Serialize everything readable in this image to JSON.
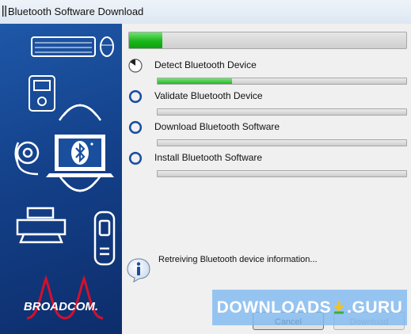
{
  "window": {
    "title": "Bluetooth Software Download"
  },
  "branding": {
    "logo_text": "BROADCOM."
  },
  "overall_progress": {
    "fraction": 0.12
  },
  "steps": [
    {
      "label": "Detect Bluetooth Device",
      "state": "in-progress",
      "progress": 0.3
    },
    {
      "label": "Validate Bluetooth Device",
      "state": "pending",
      "progress": 0
    },
    {
      "label": "Download Bluetooth Software",
      "state": "pending",
      "progress": 0
    },
    {
      "label": "Install Bluetooth Software",
      "state": "pending",
      "progress": 0
    }
  ],
  "status": {
    "message": "Retreiving Bluetooth device information...",
    "icon": "info-icon"
  },
  "buttons": {
    "cancel": "Cancel",
    "download": "Download"
  },
  "watermark": {
    "left": "DOWNLOADS",
    "right": ".GURU"
  },
  "colors": {
    "progress_green": "#19b619",
    "panel_blue": "#14418a",
    "logo_red": "#d4102c"
  }
}
